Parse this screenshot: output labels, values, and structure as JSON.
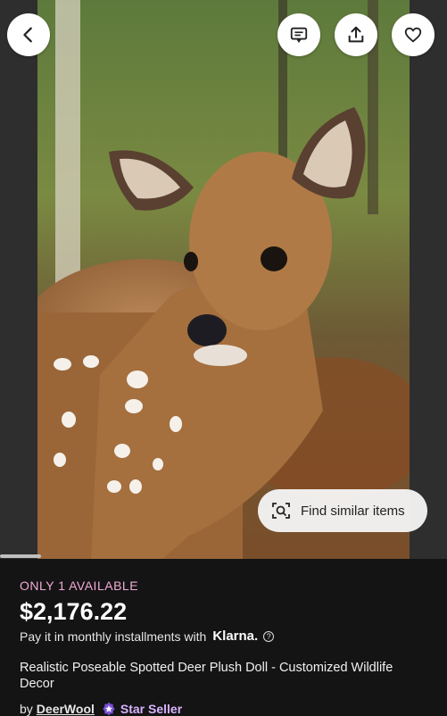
{
  "toolbar": {
    "back_icon": "chevron-left-icon",
    "messages_icon": "chat-icon",
    "share_icon": "share-icon",
    "favorite_icon": "heart-icon"
  },
  "image": {
    "find_similar_label": "Find similar items",
    "find_similar_icon": "visual-search-icon"
  },
  "listing": {
    "availability": "ONLY 1 AVAILABLE",
    "price": "$2,176.22",
    "installments_text": "Pay it in monthly installments with",
    "klarna_label": "Klarna.",
    "help_icon": "?",
    "title": "Realistic Poseable Spotted Deer Plush Doll - Customized Wildlife Decor",
    "seller_prefix": "by",
    "seller_name": "DeerWool",
    "star_seller_label": "Star Seller"
  },
  "colors": {
    "availability_pink": "#f2a9d6",
    "background": "#141414",
    "star_seller_purple": "#d9b3ff"
  }
}
